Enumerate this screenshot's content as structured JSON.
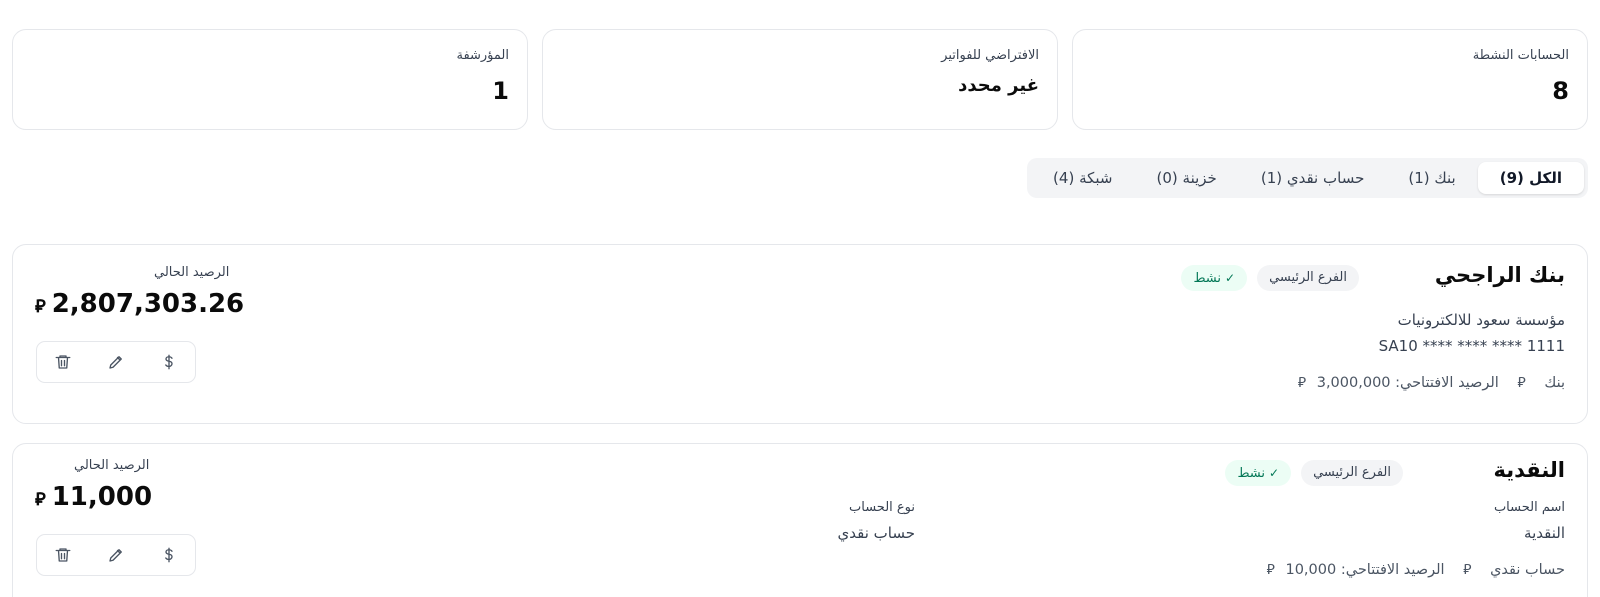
{
  "stats": [
    {
      "label": "الحسابات النشطة",
      "value": "8"
    },
    {
      "label": "الافتراضي للفواتير",
      "value": "غير محدد"
    },
    {
      "label": "المؤرشفة",
      "value": "1"
    }
  ],
  "tabs": [
    {
      "label": "الكل (9)",
      "active": true
    },
    {
      "label": "بنك (1)"
    },
    {
      "label": "حساب نقدي (1)"
    },
    {
      "label": "خزينة (0)"
    },
    {
      "label": "شبكة (4)"
    }
  ],
  "currency_symbol": "⃁",
  "accounts": [
    {
      "name": "بنك الراجحي",
      "branch": "الفرع الرئيسي",
      "status": "نشط",
      "company": "مؤسسة سعود للالكترونيات",
      "iban": "SA10 **** **** **** 1111",
      "type": "بنك",
      "opening_balance": "الرصيد الافتتاحي: 3,000,000",
      "balance_label": "الرصيد الحالي",
      "balance": "2,807,303.26"
    },
    {
      "name": "النقدية",
      "branch": "الفرع الرئيسي",
      "status": "نشط",
      "account_name_label": "اسم الحساب",
      "account_name_value": "النقدية",
      "account_type_label": "نوع الحساب",
      "account_type_value": "حساب نقدي",
      "type": "حساب نقدي",
      "opening_balance": "الرصيد الافتتاحي: 10,000",
      "balance_label": "الرصيد الحالي",
      "balance": "11,000"
    }
  ],
  "icons": {
    "check": "check-icon",
    "riyal": "riyal-icon",
    "dollar": "dollar-icon",
    "edit": "pencil-icon",
    "delete": "trash-icon"
  },
  "colors": {
    "status_bg": "#ecfdf5",
    "status_fg": "#047857",
    "chip_bg": "#f3f4f6",
    "border": "#e5e7eb"
  }
}
